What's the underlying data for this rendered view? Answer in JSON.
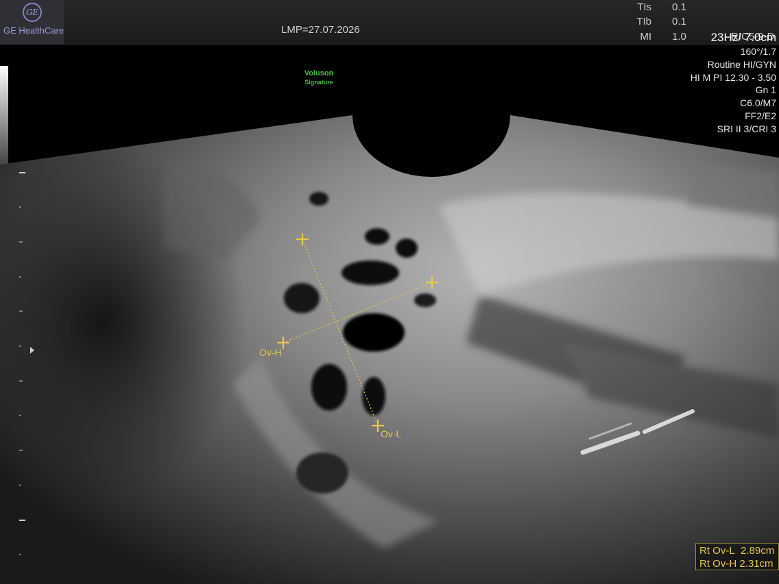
{
  "header": {
    "brand": "GE HealthCare",
    "brand_mark": "GE",
    "lmp": "LMP=27.07.2026",
    "indices": [
      {
        "label": "TIs",
        "value": "0.1"
      },
      {
        "label": "TIb",
        "value": "0.1"
      },
      {
        "label": "MI",
        "value": "1.0"
      }
    ],
    "probe": "RIC5-9-D"
  },
  "params": {
    "frame_depth": "23Hz/ 7.0cm",
    "angle": "160°/1.7",
    "preset": "Routine HI/GYN",
    "harmonic": "HI M PI 12.30 - 3.50",
    "gain": "Gn  1",
    "c_map": "C6.0/M7",
    "ff": "FF2/E2",
    "sri": "SRI II 3/CRI 3"
  },
  "watermark": {
    "line1": "Voluson",
    "line2": "Signature"
  },
  "calipers": {
    "length_caption": "Ov-L",
    "height_caption": "Ov-H"
  },
  "measurements": [
    {
      "label": "Rt Ov-L",
      "value": "2.89cm"
    },
    {
      "label": "Rt Ov-H",
      "value": "2.31cm"
    }
  ],
  "colors": {
    "caliper": "#e8c84a",
    "watermark": "#3fc23a",
    "brand": "#a09ad6"
  }
}
